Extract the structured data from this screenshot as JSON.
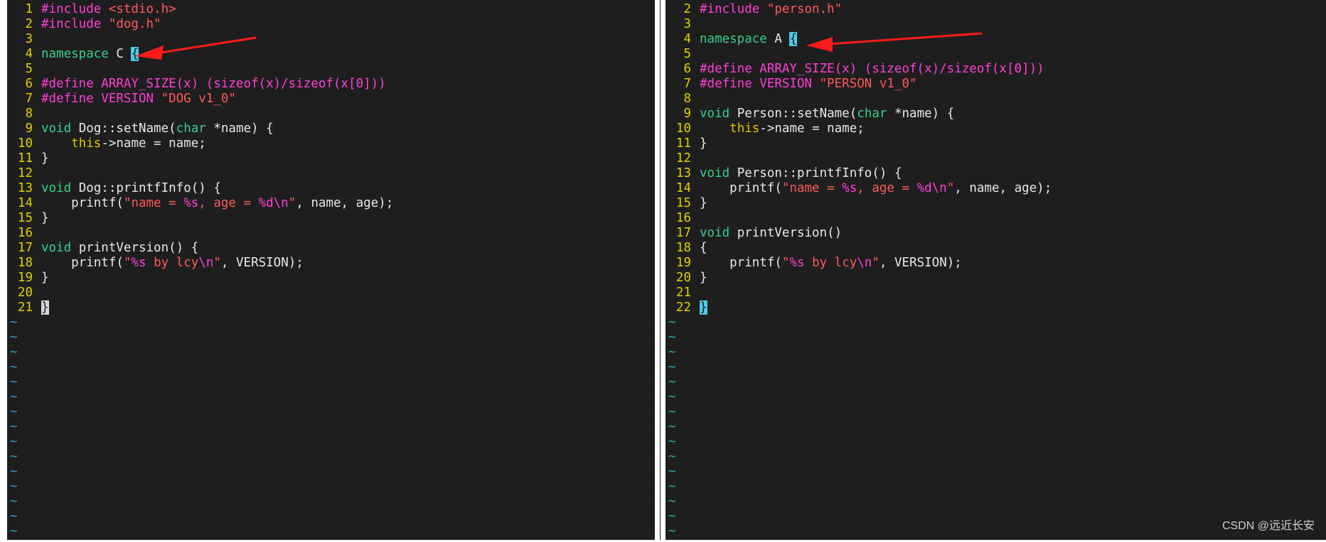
{
  "left": {
    "lines": [
      {
        "n": "1",
        "html": "<span class='pp'>#include </span><span class='str'>&lt;stdio.h&gt;</span>"
      },
      {
        "n": "2",
        "html": "<span class='pp'>#include </span><span class='str'>\"dog.h\"</span>"
      },
      {
        "n": "3",
        "html": ""
      },
      {
        "n": "4",
        "html": "<span class='kw'>namespace</span> C <span class='cursor-brace'>{</span>"
      },
      {
        "n": "5",
        "html": ""
      },
      {
        "n": "6",
        "html": "<span class='pp'>#define ARRAY_SIZE(x) (sizeof(x)/sizeof(x[0]))</span>"
      },
      {
        "n": "7",
        "html": "<span class='pp'>#define VERSION </span><span class='str'>\"DOG v1_0\"</span>"
      },
      {
        "n": "8",
        "html": ""
      },
      {
        "n": "9",
        "html": "<span class='kw'>void</span> Dog::setName(<span class='kw'>char</span> *name) {"
      },
      {
        "n": "10",
        "html": "    <span class='this'>this</span>-&gt;name = name;"
      },
      {
        "n": "11",
        "html": "}"
      },
      {
        "n": "12",
        "html": ""
      },
      {
        "n": "13",
        "html": "<span class='kw'>void</span> Dog::printfInfo() {"
      },
      {
        "n": "14",
        "html": "    printf(<span class='str'>\"name = </span><span class='fmt'>%s</span><span class='str'>, age = </span><span class='fmt'>%d\\n</span><span class='str'>\"</span>, name, age);"
      },
      {
        "n": "15",
        "html": "}"
      },
      {
        "n": "16",
        "html": ""
      },
      {
        "n": "17",
        "html": "<span class='kw'>void</span> printVersion() {"
      },
      {
        "n": "18",
        "html": "    printf(<span class='str'>\"</span><span class='fmt'>%s</span><span class='str'> by lcy</span><span class='fmt'>\\n</span><span class='str'>\"</span>, VERSION);"
      },
      {
        "n": "19",
        "html": "}"
      },
      {
        "n": "20",
        "html": ""
      },
      {
        "n": "21",
        "html": "<span class='cursor-block'>}</span>"
      }
    ],
    "tilde_count": 15
  },
  "right": {
    "lines": [
      {
        "n": "2",
        "html": "<span class='pp'>#include </span><span class='str'>\"person.h\"</span>"
      },
      {
        "n": "3",
        "html": ""
      },
      {
        "n": "4",
        "html": "<span class='kw'>namespace</span> A <span class='cursor-brace'>{</span>"
      },
      {
        "n": "5",
        "html": ""
      },
      {
        "n": "6",
        "html": "<span class='pp'>#define ARRAY_SIZE(x) (sizeof(x)/sizeof(x[0]))</span>"
      },
      {
        "n": "7",
        "html": "<span class='pp'>#define VERSION </span><span class='str'>\"PERSON v1_0\"</span>"
      },
      {
        "n": "8",
        "html": ""
      },
      {
        "n": "9",
        "html": "<span class='kw'>void</span> Person::setName(<span class='kw'>char</span> *name) {"
      },
      {
        "n": "10",
        "html": "    <span class='this'>this</span>-&gt;name = name;"
      },
      {
        "n": "11",
        "html": "}"
      },
      {
        "n": "12",
        "html": ""
      },
      {
        "n": "13",
        "html": "<span class='kw'>void</span> Person::printfInfo() {"
      },
      {
        "n": "14",
        "html": "    printf(<span class='str'>\"name = </span><span class='fmt'>%s</span><span class='str'>, age = </span><span class='fmt'>%d\\n</span><span class='str'>\"</span>, name, age);"
      },
      {
        "n": "15",
        "html": "}"
      },
      {
        "n": "16",
        "html": ""
      },
      {
        "n": "17",
        "html": "<span class='kw'>void</span> printVersion()"
      },
      {
        "n": "18",
        "html": "{"
      },
      {
        "n": "19",
        "html": "    printf(<span class='str'>\"</span><span class='fmt'>%s</span><span class='str'> by lcy</span><span class='fmt'>\\n</span><span class='str'>\"</span>, VERSION);"
      },
      {
        "n": "20",
        "html": "}"
      },
      {
        "n": "21",
        "html": ""
      },
      {
        "n": "22",
        "html": "<span class='cursor-brace'>}</span>"
      }
    ],
    "tilde_count": 15
  },
  "tilde_char": "~",
  "watermark": "CSDN @远近长安",
  "colors": {
    "background": "#1e1e1e",
    "line_number": "#e0d200",
    "preprocessor": "#ff3fd6",
    "string": "#ff5a5a",
    "keyword": "#36d08d",
    "tilde": "#2aa9c9",
    "arrow": "#ff1a1a"
  }
}
